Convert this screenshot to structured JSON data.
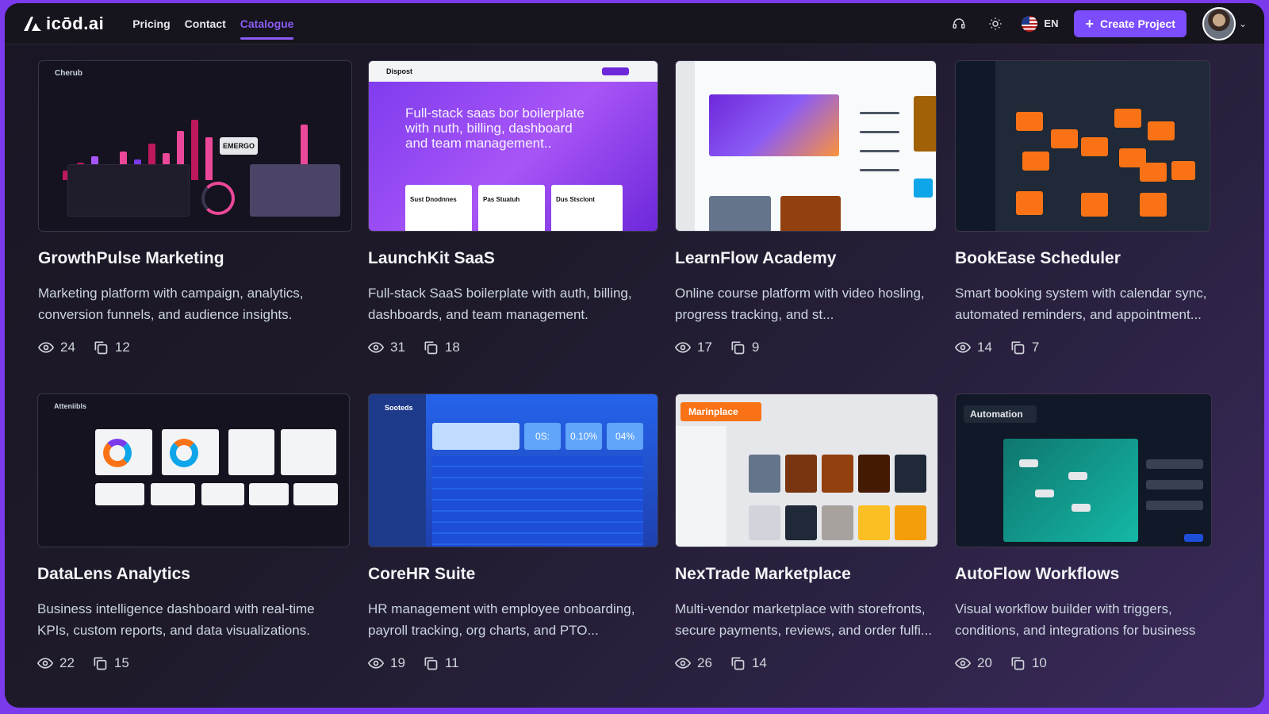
{
  "header": {
    "logo_text": "icōd.ai",
    "nav": [
      {
        "label": "Pricing",
        "active": false
      },
      {
        "label": "Contact",
        "active": false
      },
      {
        "label": "Catalogue",
        "active": true
      }
    ],
    "language": "EN",
    "create_button": "Create Project",
    "accent_color": "#7c4dff"
  },
  "cards": [
    {
      "title": "GrowthPulse Marketing",
      "desc": "Marketing platform with campaign, analytics, conversion funnels, and audience insights.",
      "views": "24",
      "copies": "12",
      "thumb_title": "Cherub",
      "thumb_badge": "EMERGO"
    },
    {
      "title": "LaunchKit SaaS",
      "desc": "Full-stack SaaS boilerplate with auth, billing, dashboards, and team management.",
      "views": "31",
      "copies": "18",
      "thumb_title": "Dispost",
      "thumb_hero": "Full-stack saas bor boilerplate with nuth, billing, dashboard and team management..",
      "thumb_cards": [
        "Sust Dnodnnes",
        "Pas Stuatuh",
        "Dus Stsclont"
      ]
    },
    {
      "title": "LearnFlow Academy",
      "desc": "Online course platform with video hosling, progress tracking, and st...",
      "views": "17",
      "copies": "9"
    },
    {
      "title": "BookEase Scheduler",
      "desc": "Smart booking system with calendar sync, automated reminders, and appointment...",
      "views": "14",
      "copies": "7"
    },
    {
      "title": "DataLens Analytics",
      "desc": "Business intelligence dashboard with real-time KPIs, custom reports, and data visualizations.",
      "views": "22",
      "copies": "15",
      "thumb_title": "Atteniibls"
    },
    {
      "title": "CoreHR Suite",
      "desc": "HR management with employee onboarding, payroll tracking, org charts, and PTO...",
      "views": "19",
      "copies": "11",
      "thumb_title": "Sooteds",
      "thumb_kpis": [
        "0S:",
        "0.10%",
        "04%"
      ]
    },
    {
      "title": "NexTrade Marketplace",
      "desc": "Multi-vendor marketplace with storefronts, secure payments, reviews, and order fulfi...",
      "views": "26",
      "copies": "14",
      "thumb_badge": "Marinplace"
    },
    {
      "title": "AutoFlow Workflows",
      "desc": "Visual workflow builder with triggers, conditions, and integrations for business aut...",
      "views": "20",
      "copies": "10",
      "thumb_badge": "Automation"
    }
  ]
}
